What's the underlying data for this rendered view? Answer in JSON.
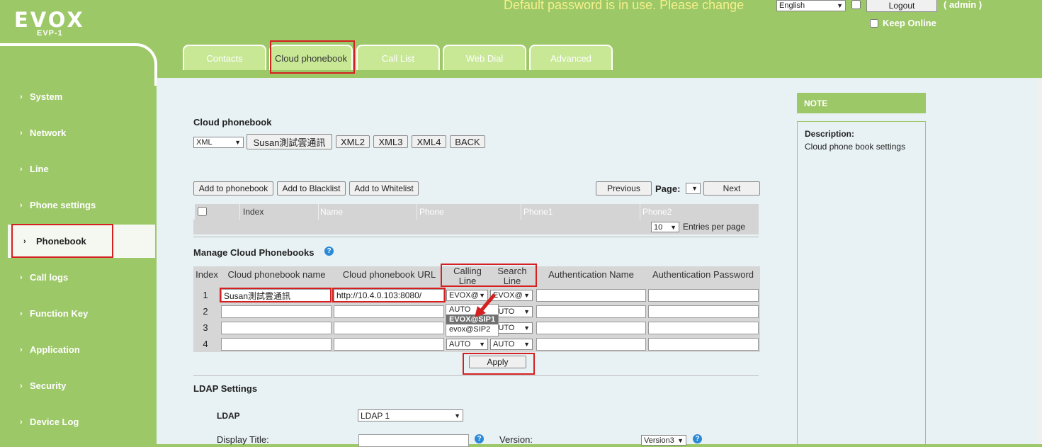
{
  "header": {
    "brand": "EVOX",
    "model": "EVP-1",
    "warning": "Default password is in use. Please change",
    "language": "English",
    "logout": "Logout",
    "user": "( admin )",
    "keep_online": "Keep Online"
  },
  "sidebar": {
    "items": [
      {
        "label": "System"
      },
      {
        "label": "Network"
      },
      {
        "label": "Line"
      },
      {
        "label": "Phone settings"
      },
      {
        "label": "Phonebook"
      },
      {
        "label": "Call logs"
      },
      {
        "label": "Function Key"
      },
      {
        "label": "Application"
      },
      {
        "label": "Security"
      },
      {
        "label": "Device Log"
      }
    ],
    "active": "Phonebook"
  },
  "tabs": [
    {
      "label": "Contacts"
    },
    {
      "label": "Cloud phonebook"
    },
    {
      "label": "Call List"
    },
    {
      "label": "Web Dial"
    },
    {
      "label": "Advanced"
    }
  ],
  "cloud": {
    "title": "Cloud phonebook",
    "format": "XML",
    "books": [
      "Susan測試雲通訊",
      "XML2",
      "XML3",
      "XML4",
      "BACK"
    ]
  },
  "contacts": {
    "add_phonebook": "Add to phonebook",
    "add_blacklist": "Add to Blacklist",
    "add_whitelist": "Add to Whitelist",
    "previous": "Previous",
    "page_label": "Page:",
    "next": "Next",
    "columns": [
      "Index",
      "Name",
      "Phone",
      "Phone1",
      "Phone2"
    ],
    "entries": "10",
    "entries_label": "Entries per page"
  },
  "manage": {
    "title": "Manage Cloud Phonebooks",
    "columns": {
      "index": "Index",
      "name": "Cloud phonebook name",
      "url": "Cloud phonebook URL",
      "calling": "Calling Line",
      "search": "Search Line",
      "auth_name": "Authentication Name",
      "auth_pass": "Authentication Password"
    },
    "rows": [
      {
        "index": "1",
        "name": "Susan測試雲通訊",
        "url": "http://10.4.0.103:8080/",
        "calling": "EVOX@",
        "search": "EVOX@"
      },
      {
        "index": "2",
        "name": "",
        "url": "",
        "calling": "",
        "search": "AUTO"
      },
      {
        "index": "3",
        "name": "",
        "url": "",
        "calling": "",
        "search": "AUTO"
      },
      {
        "index": "4",
        "name": "",
        "url": "",
        "calling": "AUTO",
        "search": "AUTO"
      }
    ],
    "dropdown_options": [
      "AUTO",
      "EVOX@SIP1",
      "evox@SIP2"
    ],
    "apply": "Apply"
  },
  "ldap": {
    "title": "LDAP Settings",
    "ldap_label": "LDAP",
    "ldap_value": "LDAP 1",
    "display_title_label": "Display Title:",
    "version_label": "Version:",
    "version_value": "Version3"
  },
  "note": {
    "title": "NOTE",
    "desc_label": "Description:",
    "desc_text": "Cloud phone book settings"
  },
  "colors": {
    "green": "#9dc868",
    "tab_bg": "#c8e896",
    "content_bg": "#e8f1f4",
    "highlight_red": "#d42020",
    "warning_text": "#f4f08c"
  }
}
